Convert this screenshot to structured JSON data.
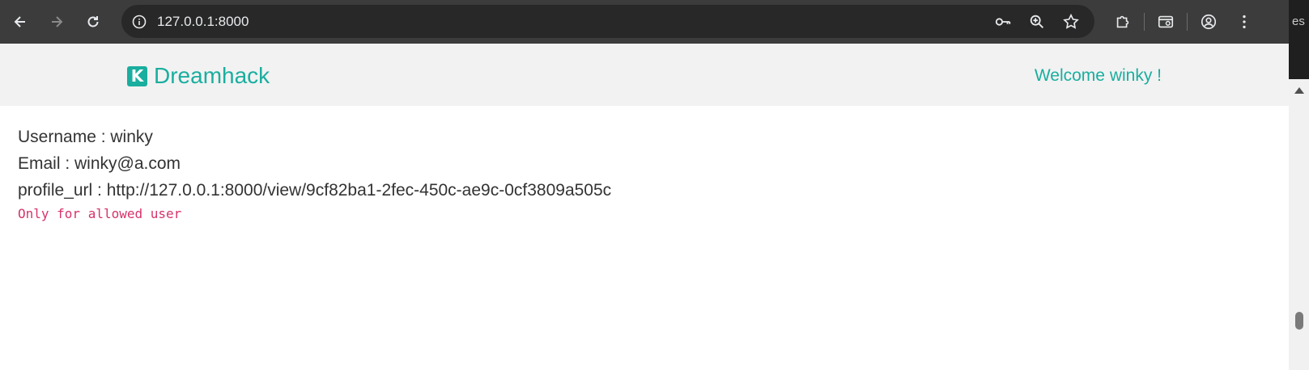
{
  "browser": {
    "url": "127.0.0.1:8000",
    "partial_tab_text": "es"
  },
  "navbar": {
    "brand_logo_letter": "K",
    "brand_name": "Dreamhack",
    "welcome": "Welcome winky !"
  },
  "profile": {
    "username_line": "Username : winky",
    "email_line": "Email : winky@a.com",
    "profile_url_line": "profile_url : http://127.0.0.1:8000/view/9cf82ba1-2fec-450c-ae9c-0cf3809a505c",
    "notice": "Only for allowed user"
  },
  "colors": {
    "accent": "#1aae9f",
    "code": "#d6336c",
    "chrome": "#3c3c3c"
  }
}
